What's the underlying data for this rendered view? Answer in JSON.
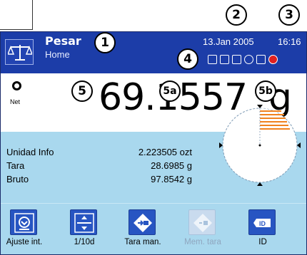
{
  "header": {
    "app_name": "Pesar",
    "app_sub": "Home",
    "date": "13.Jan 2005",
    "time": "16:16"
  },
  "weight": {
    "value": "69.1557",
    "unit": "g",
    "net_label": "Net"
  },
  "info": {
    "rows": [
      {
        "label": "Unidad Info",
        "value": "2.223505 ozt"
      },
      {
        "label": "Tara",
        "value": "28.6985 g"
      },
      {
        "label": "Bruto",
        "value": "97.8542 g"
      }
    ]
  },
  "toolbar": {
    "items": [
      {
        "label": "Ajuste int.",
        "icon": "calibration-icon",
        "enabled": true
      },
      {
        "label": "1/10d",
        "icon": "resolution-icon",
        "enabled": true
      },
      {
        "label": "Tara man.",
        "icon": "preset-tare-icon",
        "enabled": true
      },
      {
        "label": "Mem. tara",
        "icon": "tare-memory-icon",
        "enabled": false
      },
      {
        "label": "ID",
        "icon": "id-tag-icon",
        "enabled": true
      }
    ]
  },
  "callouts": [
    "1",
    "2",
    "3",
    "4",
    "5",
    "5a",
    "5b"
  ],
  "colors": {
    "header_bg": "#1c3da8",
    "panel_bg": "#a9d8ee",
    "button_bg": "#2755c2",
    "dial_fill": "#f0821e"
  }
}
